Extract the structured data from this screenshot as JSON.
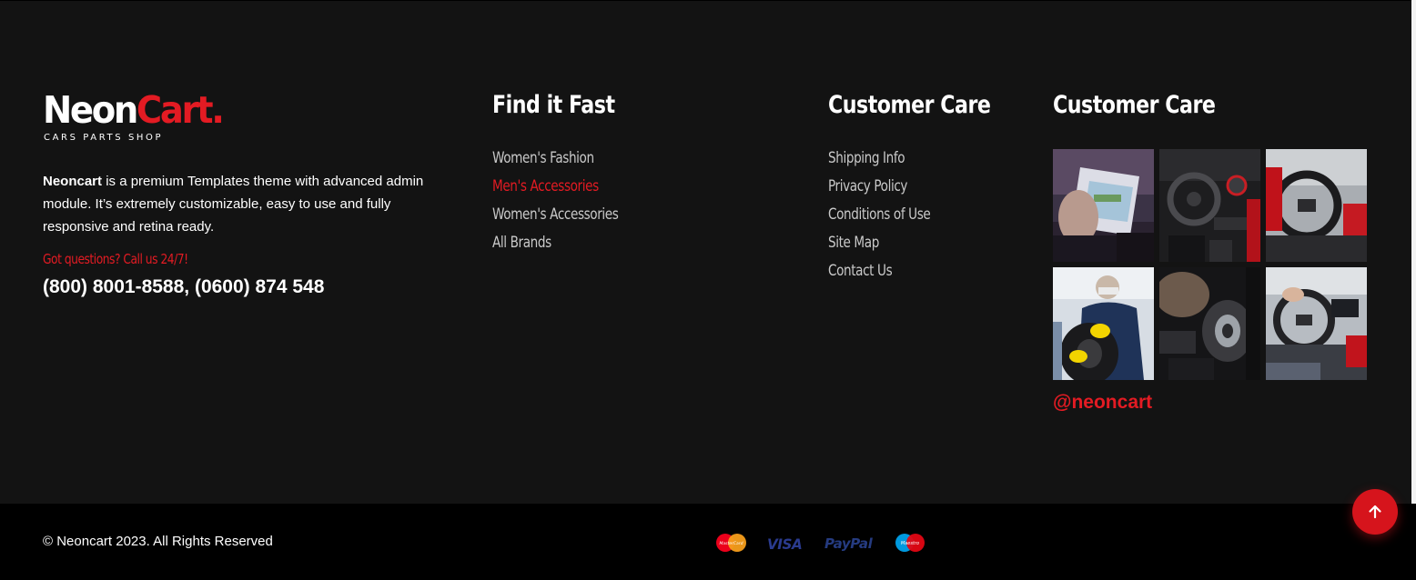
{
  "brand": {
    "name_part1": "Neon",
    "name_part2": "Cart.",
    "tagline": "CARS PARTS SHOP",
    "accent_color": "#e31b23"
  },
  "about": {
    "brand_name": "Neoncart",
    "description": " is a premium Templates theme with advanced admin module. It’s extremely customizable, easy to use and fully responsive and retina ready."
  },
  "contact": {
    "questions_label": "Got questions? Call us 24/7!",
    "phones": "(800) 8001-8588, (0600) 874 548"
  },
  "find_it_fast": {
    "title": "Find it Fast",
    "links": [
      {
        "label": "Women's Fashion",
        "active": false
      },
      {
        "label": "Men's Accessories",
        "active": true
      },
      {
        "label": "Women's Accessories",
        "active": false
      },
      {
        "label": "All Brands",
        "active": false
      }
    ]
  },
  "customer_care": {
    "title": "Customer Care",
    "links": [
      {
        "label": "Shipping Info"
      },
      {
        "label": "Privacy Policy"
      },
      {
        "label": "Conditions of Use"
      },
      {
        "label": "Site Map"
      },
      {
        "label": "Contact Us"
      }
    ]
  },
  "instagram": {
    "title": "Customer Care",
    "handle": "@neoncart",
    "images": [
      {
        "name": "car-paperwork-image"
      },
      {
        "name": "car-dashboard-image"
      },
      {
        "name": "steering-wheel-image"
      },
      {
        "name": "tire-mechanic-image"
      },
      {
        "name": "engine-part-image"
      },
      {
        "name": "car-interior-image"
      }
    ]
  },
  "bottom_bar": {
    "copyright": "© Neoncart 2023. All Rights Reserved",
    "payment_methods": [
      {
        "name": "MasterCard",
        "icon": "mastercard-icon"
      },
      {
        "name": "VISA",
        "icon": "visa-icon"
      },
      {
        "name": "PayPal",
        "icon": "paypal-icon"
      },
      {
        "name": "Maestro",
        "icon": "maestro-icon"
      }
    ]
  },
  "scroll_top": {
    "icon": "arrow-up-icon",
    "color": "#d6141c"
  }
}
